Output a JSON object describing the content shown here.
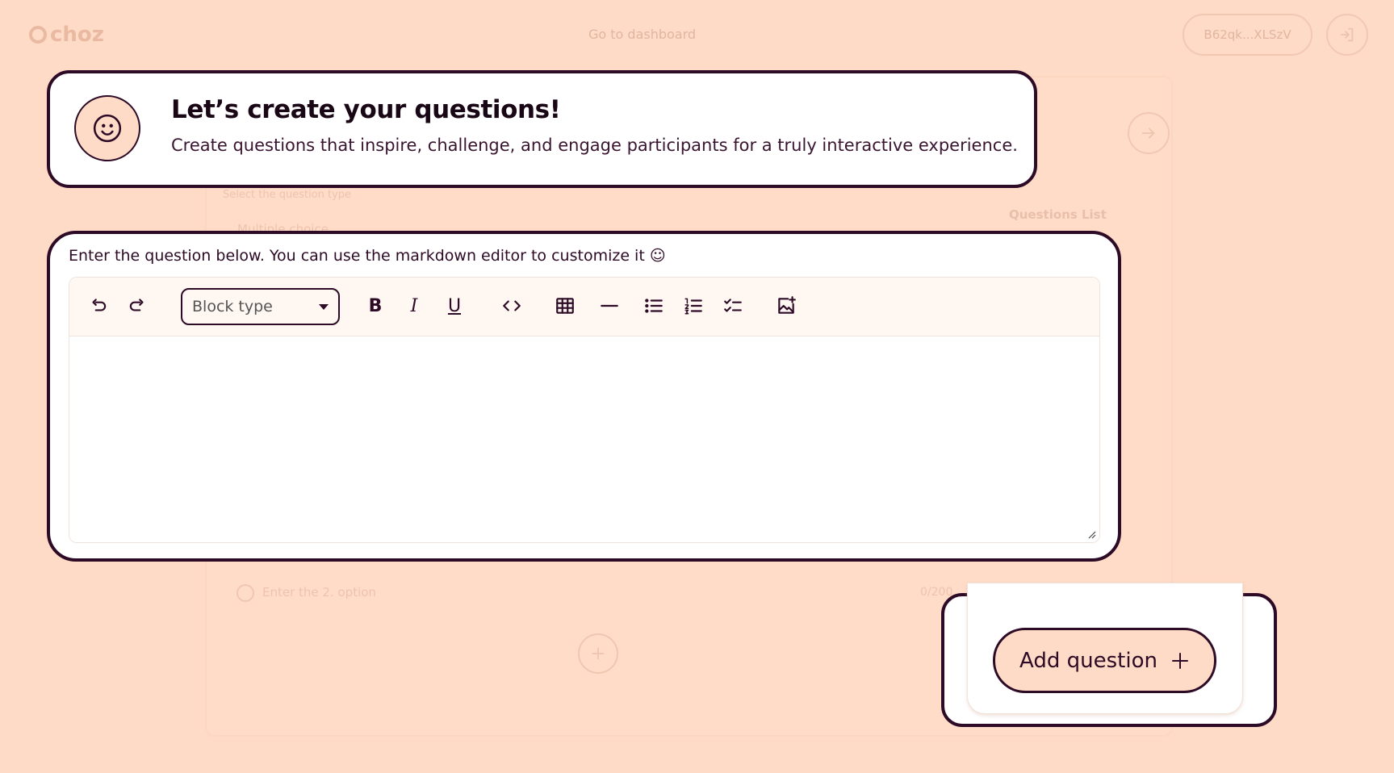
{
  "app": {
    "logo_text": "choz",
    "dashboard_link": "Go to dashboard",
    "wallet_label": "B62qk...XLSzV"
  },
  "background_form": {
    "question_type_label": "Select the question type",
    "question_type_value": "Multiple choice",
    "questions_list_title": "Questions List",
    "option_placeholder": "Enter the 2. option",
    "option_counter": "0/200"
  },
  "intro": {
    "title": "Let’s create your questions!",
    "description": "Create questions that inspire, challenge, and engage participants for a truly interactive experience."
  },
  "editor": {
    "label": "Enter the question below. You can use the markdown editor to customize it ☺",
    "block_type_label": "Block type",
    "toolbar": [
      {
        "name": "undo-icon"
      },
      {
        "name": "redo-icon"
      },
      {
        "name": "bold-icon",
        "glyph": "B"
      },
      {
        "name": "italic-icon",
        "glyph": "I"
      },
      {
        "name": "underline-icon",
        "glyph": "U"
      },
      {
        "name": "code-icon"
      },
      {
        "name": "table-icon"
      },
      {
        "name": "horizontal-rule-icon"
      },
      {
        "name": "bullet-list-icon"
      },
      {
        "name": "numbered-list-icon"
      },
      {
        "name": "checklist-icon"
      },
      {
        "name": "insert-image-icon"
      }
    ],
    "content": ""
  },
  "actions": {
    "add_question_label": "Add question",
    "add_question_icon": "plus-icon"
  },
  "colors": {
    "background": "#fedbc6",
    "ink": "#2d0a25",
    "card": "#ffffff",
    "toolbar_bg": "#fff7f2"
  }
}
